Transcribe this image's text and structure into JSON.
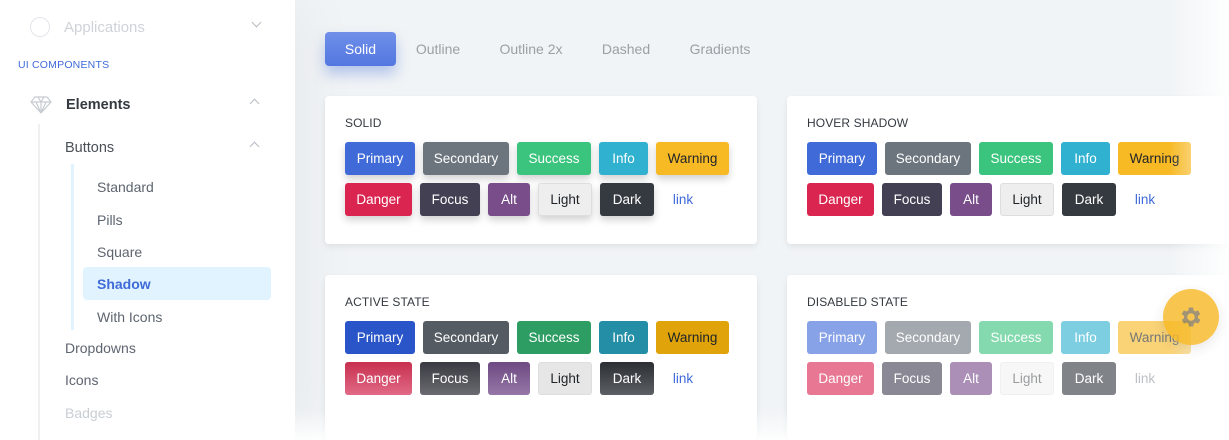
{
  "sidebar": {
    "applications_label": "Applications",
    "section_title": "UI COMPONENTS",
    "elements_label": "Elements",
    "buttons_label": "Buttons",
    "sub_items": [
      "Standard",
      "Pills",
      "Square",
      "Shadow",
      "With Icons"
    ],
    "active_sub_item": "Shadow",
    "dropdowns_label": "Dropdowns",
    "icons_label": "Icons",
    "badges_label": "Badges"
  },
  "tabs": [
    "Solid",
    "Outline",
    "Outline 2x",
    "Dashed",
    "Gradients"
  ],
  "active_tab": "Solid",
  "cards": {
    "solid": {
      "title": "SOLID"
    },
    "hover": {
      "title": "HOVER SHADOW"
    },
    "active": {
      "title": "ACTIVE STATE"
    },
    "disabled": {
      "title": "DISABLED STATE"
    }
  },
  "buttons": {
    "primary": "Primary",
    "secondary": "Secondary",
    "success": "Success",
    "info": "Info",
    "warning": "Warning",
    "danger": "Danger",
    "focus": "Focus",
    "alt": "Alt",
    "light": "Light",
    "dark": "Dark",
    "link": "link"
  },
  "icons": {
    "applications": "circle-icon",
    "elements": "gem-icon",
    "settings": "gear-icon"
  },
  "colors": {
    "primary": "#3f6ad8",
    "secondary": "#6c757d",
    "success": "#3ac47d",
    "info": "#30b1d0",
    "warning": "#f7b924",
    "danger": "#d92550",
    "focus": "#444054",
    "alt": "#794c8a",
    "light": "#eeeeee",
    "dark": "#343a40"
  }
}
